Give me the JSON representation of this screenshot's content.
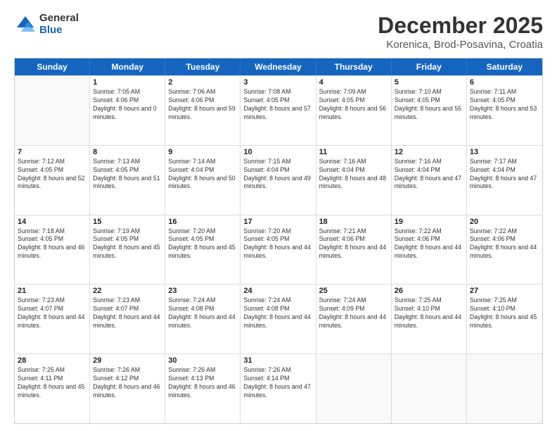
{
  "logo": {
    "general": "General",
    "blue": "Blue"
  },
  "header": {
    "title": "December 2025",
    "subtitle": "Korenica, Brod-Posavina, Croatia"
  },
  "weekdays": [
    "Sunday",
    "Monday",
    "Tuesday",
    "Wednesday",
    "Thursday",
    "Friday",
    "Saturday"
  ],
  "weeks": [
    [
      {
        "day": "",
        "empty": true
      },
      {
        "day": "1",
        "sunrise": "Sunrise: 7:05 AM",
        "sunset": "Sunset: 4:06 PM",
        "daylight": "Daylight: 8 hours and 0 minutes."
      },
      {
        "day": "2",
        "sunrise": "Sunrise: 7:06 AM",
        "sunset": "Sunset: 4:06 PM",
        "daylight": "Daylight: 8 hours and 59 minutes."
      },
      {
        "day": "3",
        "sunrise": "Sunrise: 7:08 AM",
        "sunset": "Sunset: 4:05 PM",
        "daylight": "Daylight: 8 hours and 57 minutes."
      },
      {
        "day": "4",
        "sunrise": "Sunrise: 7:09 AM",
        "sunset": "Sunset: 4:05 PM",
        "daylight": "Daylight: 8 hours and 56 minutes."
      },
      {
        "day": "5",
        "sunrise": "Sunrise: 7:10 AM",
        "sunset": "Sunset: 4:05 PM",
        "daylight": "Daylight: 8 hours and 55 minutes."
      },
      {
        "day": "6",
        "sunrise": "Sunrise: 7:11 AM",
        "sunset": "Sunset: 4:05 PM",
        "daylight": "Daylight: 8 hours and 53 minutes."
      }
    ],
    [
      {
        "day": "7",
        "sunrise": "Sunrise: 7:12 AM",
        "sunset": "Sunset: 4:05 PM",
        "daylight": "Daylight: 8 hours and 52 minutes."
      },
      {
        "day": "8",
        "sunrise": "Sunrise: 7:13 AM",
        "sunset": "Sunset: 4:05 PM",
        "daylight": "Daylight: 8 hours and 51 minutes."
      },
      {
        "day": "9",
        "sunrise": "Sunrise: 7:14 AM",
        "sunset": "Sunset: 4:04 PM",
        "daylight": "Daylight: 8 hours and 50 minutes."
      },
      {
        "day": "10",
        "sunrise": "Sunrise: 7:15 AM",
        "sunset": "Sunset: 4:04 PM",
        "daylight": "Daylight: 8 hours and 49 minutes."
      },
      {
        "day": "11",
        "sunrise": "Sunrise: 7:16 AM",
        "sunset": "Sunset: 4:04 PM",
        "daylight": "Daylight: 8 hours and 48 minutes."
      },
      {
        "day": "12",
        "sunrise": "Sunrise: 7:16 AM",
        "sunset": "Sunset: 4:04 PM",
        "daylight": "Daylight: 8 hours and 47 minutes."
      },
      {
        "day": "13",
        "sunrise": "Sunrise: 7:17 AM",
        "sunset": "Sunset: 4:04 PM",
        "daylight": "Daylight: 8 hours and 47 minutes."
      }
    ],
    [
      {
        "day": "14",
        "sunrise": "Sunrise: 7:18 AM",
        "sunset": "Sunset: 4:05 PM",
        "daylight": "Daylight: 8 hours and 46 minutes."
      },
      {
        "day": "15",
        "sunrise": "Sunrise: 7:19 AM",
        "sunset": "Sunset: 4:05 PM",
        "daylight": "Daylight: 8 hours and 45 minutes."
      },
      {
        "day": "16",
        "sunrise": "Sunrise: 7:20 AM",
        "sunset": "Sunset: 4:05 PM",
        "daylight": "Daylight: 8 hours and 45 minutes."
      },
      {
        "day": "17",
        "sunrise": "Sunrise: 7:20 AM",
        "sunset": "Sunset: 4:05 PM",
        "daylight": "Daylight: 8 hours and 44 minutes."
      },
      {
        "day": "18",
        "sunrise": "Sunrise: 7:21 AM",
        "sunset": "Sunset: 4:06 PM",
        "daylight": "Daylight: 8 hours and 44 minutes."
      },
      {
        "day": "19",
        "sunrise": "Sunrise: 7:22 AM",
        "sunset": "Sunset: 4:06 PM",
        "daylight": "Daylight: 8 hours and 44 minutes."
      },
      {
        "day": "20",
        "sunrise": "Sunrise: 7:22 AM",
        "sunset": "Sunset: 4:06 PM",
        "daylight": "Daylight: 8 hours and 44 minutes."
      }
    ],
    [
      {
        "day": "21",
        "sunrise": "Sunrise: 7:23 AM",
        "sunset": "Sunset: 4:07 PM",
        "daylight": "Daylight: 8 hours and 44 minutes."
      },
      {
        "day": "22",
        "sunrise": "Sunrise: 7:23 AM",
        "sunset": "Sunset: 4:07 PM",
        "daylight": "Daylight: 8 hours and 44 minutes."
      },
      {
        "day": "23",
        "sunrise": "Sunrise: 7:24 AM",
        "sunset": "Sunset: 4:08 PM",
        "daylight": "Daylight: 8 hours and 44 minutes."
      },
      {
        "day": "24",
        "sunrise": "Sunrise: 7:24 AM",
        "sunset": "Sunset: 4:08 PM",
        "daylight": "Daylight: 8 hours and 44 minutes."
      },
      {
        "day": "25",
        "sunrise": "Sunrise: 7:24 AM",
        "sunset": "Sunset: 4:09 PM",
        "daylight": "Daylight: 8 hours and 44 minutes."
      },
      {
        "day": "26",
        "sunrise": "Sunrise: 7:25 AM",
        "sunset": "Sunset: 4:10 PM",
        "daylight": "Daylight: 8 hours and 44 minutes."
      },
      {
        "day": "27",
        "sunrise": "Sunrise: 7:25 AM",
        "sunset": "Sunset: 4:10 PM",
        "daylight": "Daylight: 8 hours and 45 minutes."
      }
    ],
    [
      {
        "day": "28",
        "sunrise": "Sunrise: 7:25 AM",
        "sunset": "Sunset: 4:11 PM",
        "daylight": "Daylight: 8 hours and 45 minutes."
      },
      {
        "day": "29",
        "sunrise": "Sunrise: 7:26 AM",
        "sunset": "Sunset: 4:12 PM",
        "daylight": "Daylight: 8 hours and 46 minutes."
      },
      {
        "day": "30",
        "sunrise": "Sunrise: 7:26 AM",
        "sunset": "Sunset: 4:13 PM",
        "daylight": "Daylight: 8 hours and 46 minutes."
      },
      {
        "day": "31",
        "sunrise": "Sunrise: 7:26 AM",
        "sunset": "Sunset: 4:14 PM",
        "daylight": "Daylight: 8 hours and 47 minutes."
      },
      {
        "day": "",
        "empty": true
      },
      {
        "day": "",
        "empty": true
      },
      {
        "day": "",
        "empty": true
      }
    ]
  ]
}
